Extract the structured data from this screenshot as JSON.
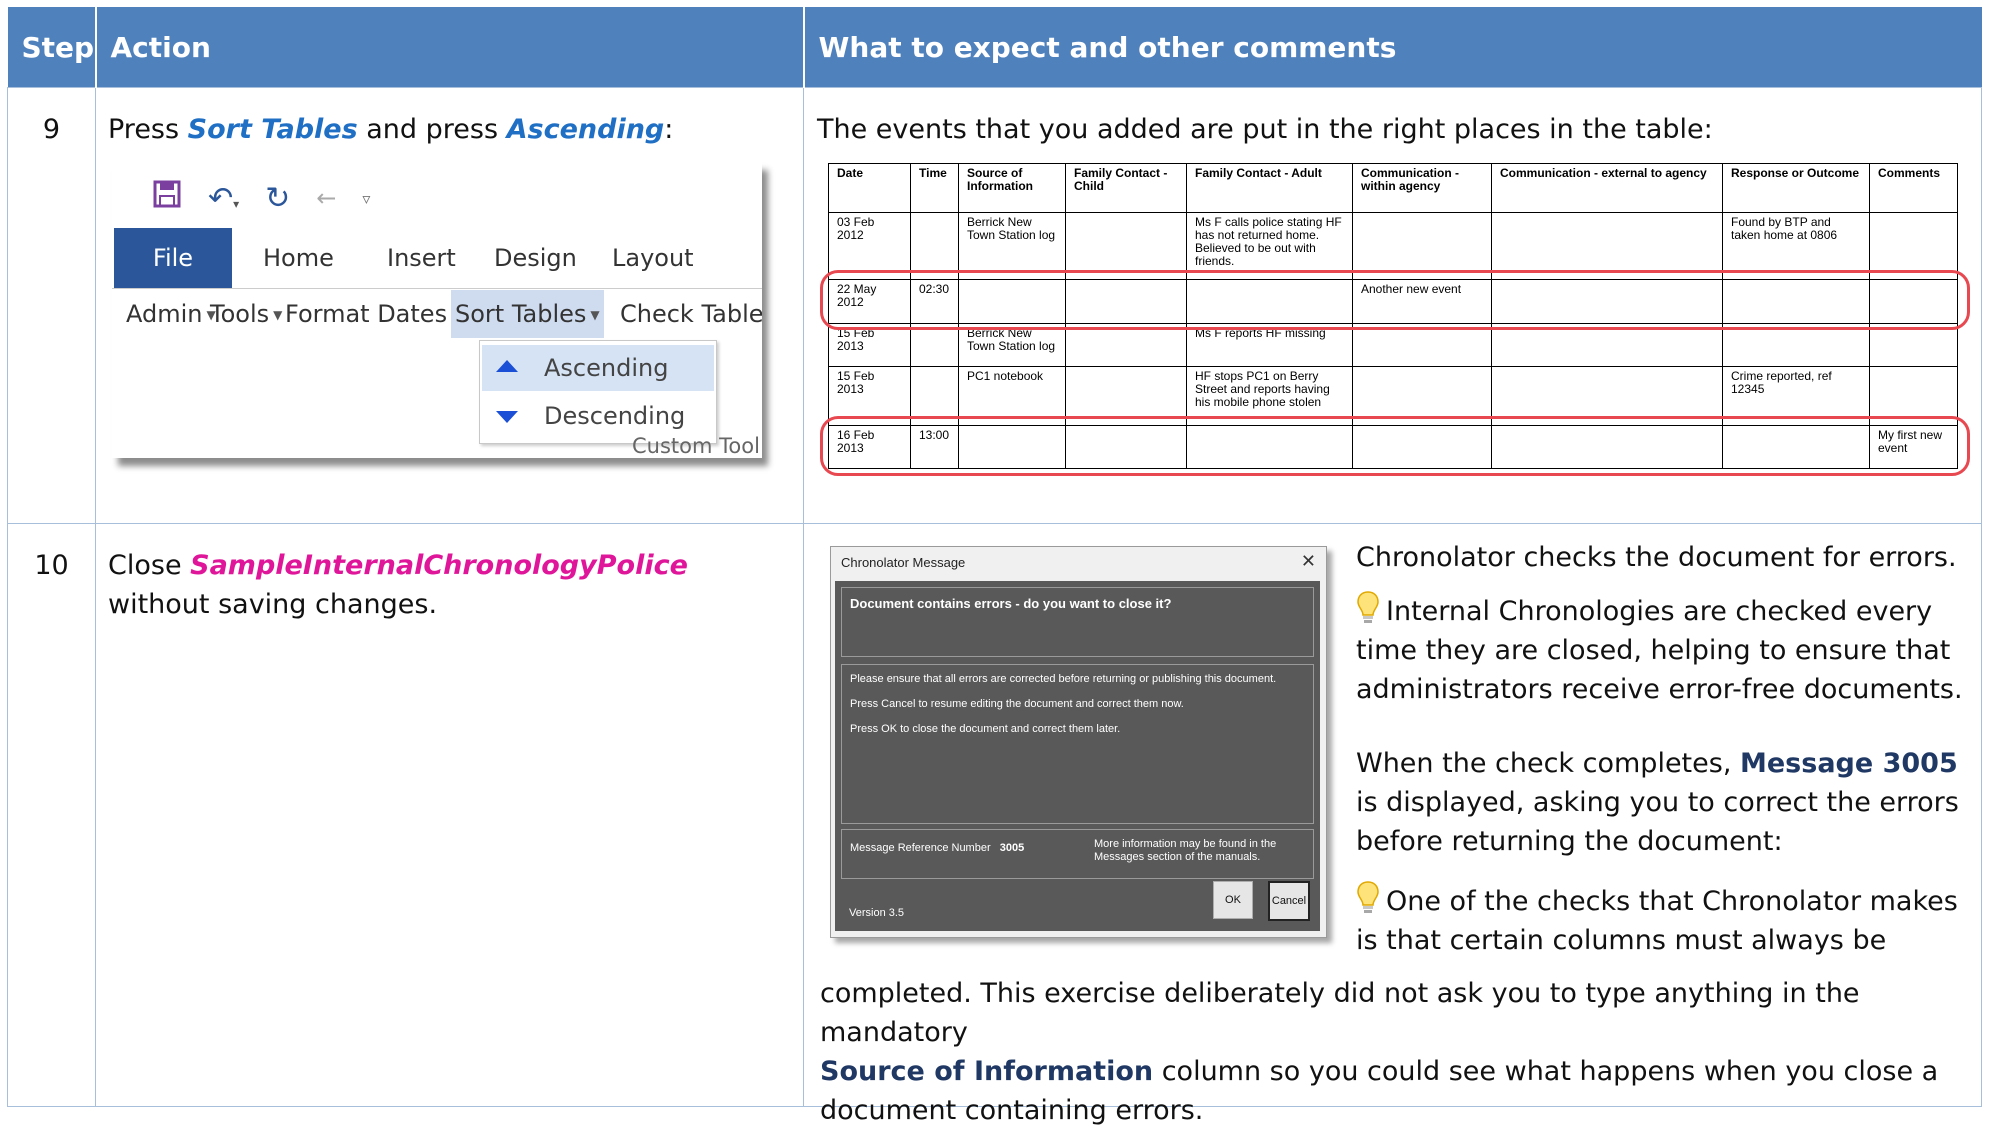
{
  "header": {
    "step": "Step",
    "action": "Action",
    "expect": "What to expect and other comments"
  },
  "row9": {
    "step": "9",
    "action_pre": "Press ",
    "action_sort": "Sort Tables",
    "action_mid": " and press ",
    "action_asc": "Ascending",
    "action_post": ":",
    "expect": "The events that you added are put in the right places in the table:",
    "ribbon": {
      "tabs": [
        "File",
        "Home",
        "Insert",
        "Design",
        "Layout"
      ],
      "menus": [
        "Admin",
        "Tools",
        "Format Dates",
        "Sort Tables",
        "Check Tables"
      ],
      "dropdown": [
        "Ascending",
        "Descending"
      ],
      "group_label": "Custom Tool"
    },
    "table": {
      "headers": [
        "Date",
        "Time",
        "Source of Information",
        "Family Contact - Child",
        "Family Contact - Adult",
        "Communication - within agency",
        "Communication - external to agency",
        "Response or Outcome",
        "Comments"
      ],
      "rows": [
        [
          "03 Feb 2012",
          "",
          "Berrick New Town Station log",
          "",
          "Ms F calls police stating HF has not returned home. Believed to be out with friends.",
          "",
          "",
          "Found by BTP and taken home at 0806",
          ""
        ],
        [
          "22 May 2012",
          "02:30",
          "",
          "",
          "",
          "Another new event",
          "",
          "",
          ""
        ],
        [
          "15 Feb 2013",
          "",
          "Berrick New Town Station log",
          "",
          "Ms F reports HF missing",
          "",
          "",
          "",
          ""
        ],
        [
          "15 Feb 2013",
          "",
          "PC1 notebook",
          "",
          "HF stops PC1 on Berry Street and reports having his mobile phone stolen",
          "",
          "",
          "Crime reported, ref 12345",
          ""
        ],
        [
          "16 Feb 2013",
          "13:00",
          "",
          "",
          "",
          "",
          "",
          "",
          "My first new event"
        ]
      ]
    }
  },
  "row10": {
    "step": "10",
    "action_pre": "Close ",
    "action_doc": "SampleInternalChronologyPolice",
    "action_post": "without saving changes.",
    "p1": "Chronolator checks the document for errors.",
    "p2": "Internal Chronologies are checked every time they are closed, helping to ensure that administrators receive error-free documents.",
    "p3_pre": "When the check completes, ",
    "p3_bold": "Message 3005",
    "p3_post": " is displayed, asking you to correct the errors before returning the document:",
    "p4_line1": "One of the checks that Chronolator makes",
    "p4_line2": "is that certain columns must always be",
    "p4_line3": "completed. This exercise deliberately did not ask you to type anything in the mandatory",
    "p4_bold": "Source of Information",
    "p4_line4_post": " column so you could see what happens when you close a",
    "p4_line5": "document containing errors.",
    "dialog": {
      "title": "Chronolator Message",
      "heading": "Document contains errors - do you want to close it?",
      "body": [
        "Please ensure that all errors are corrected before returning or publishing this document.",
        "Press Cancel to resume editing the document and correct them now.",
        "Press OK to close the document and correct them later."
      ],
      "ref_label": "Message Reference Number",
      "ref_number": "3005",
      "more_info": "More information may be found in the Messages section of the manuals.",
      "version": "Version 3.5",
      "ok": "OK",
      "cancel": "Cancel"
    }
  },
  "colors": {
    "header_bg": "#4f81bd",
    "highlight": "#e8484f",
    "link_blue": "#1f6fc5",
    "doc_pink": "#e0169a",
    "navy": "#1f3864"
  }
}
